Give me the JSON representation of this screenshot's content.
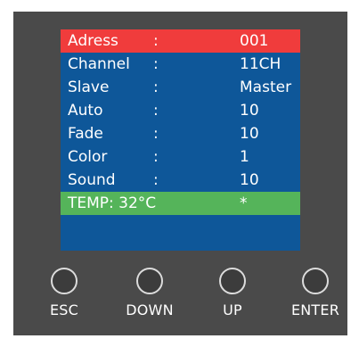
{
  "menu": {
    "rows": [
      {
        "label": "Adress",
        "colon": ":",
        "value": "001"
      },
      {
        "label": "Channel",
        "colon": ":",
        "value": "11CH"
      },
      {
        "label": "Slave",
        "colon": ":",
        "value": "Master"
      },
      {
        "label": "Auto",
        "colon": ":",
        "value": "10"
      },
      {
        "label": "Fade",
        "colon": ":",
        "value": "10"
      },
      {
        "label": "Color",
        "colon": ":",
        "value": "1"
      },
      {
        "label": "Sound",
        "colon": ":",
        "value": "10"
      }
    ],
    "temp": {
      "label": "TEMP: 32°C",
      "value": "*"
    }
  },
  "buttons": {
    "esc": "ESC",
    "down": "DOWN",
    "up": "UP",
    "enter": "ENTER"
  },
  "colors": {
    "device_body": "#4a4a4a",
    "screen_bg": "#0e5799",
    "selected_row": "#f03c3c",
    "temp_row": "#55b45a",
    "text": "#ffffff"
  }
}
